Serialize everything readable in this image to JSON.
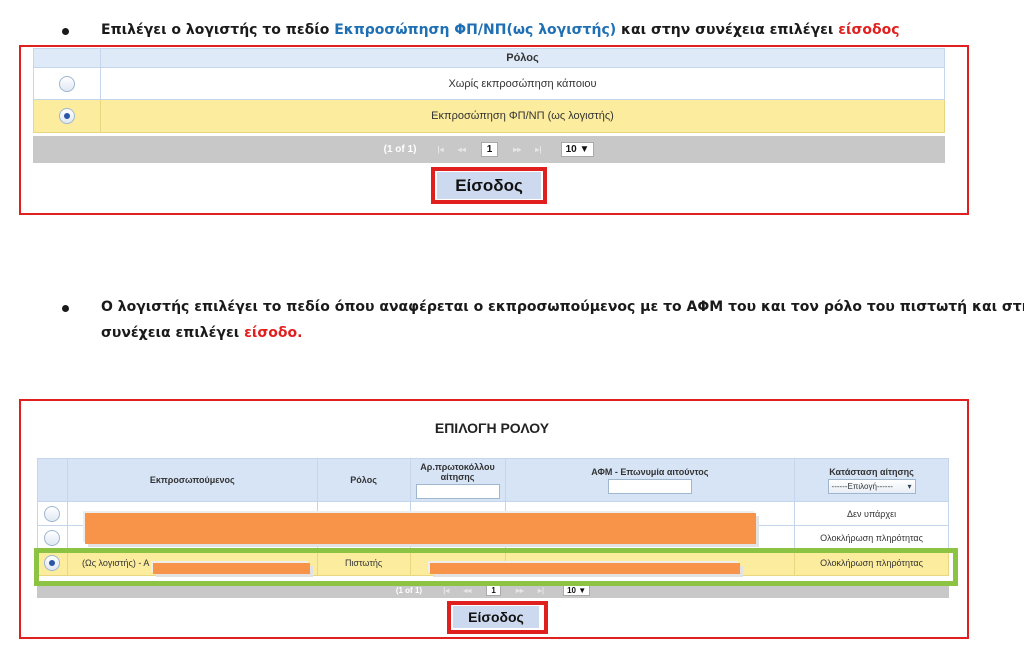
{
  "step1": {
    "text_before": "Επιλέγει ο λογιστής το πεδίο ",
    "highlight": "Εκπροσώπηση ΦΠ/ΝΠ(ως λογιστής)",
    "text_middle": " και στην συνέχεια επιλέγει ",
    "action": "είσοδος"
  },
  "panel1": {
    "column_header": "Ρόλος",
    "rows": [
      {
        "label": "Χωρίς εκπροσώπηση κάποιου",
        "selected": false
      },
      {
        "label": "Εκπροσώπηση ΦΠ/ΝΠ (ως λογιστής)",
        "selected": true
      }
    ],
    "pager": {
      "info": "(1 of 1)",
      "first": "|◂",
      "prev": "◂◂",
      "page": "1",
      "next": "▸▸",
      "last": "▸|",
      "per_page": "10 ▼"
    },
    "enter_button": "Είσοδος"
  },
  "step2": {
    "line1": "Ο λογιστής επιλέγει το πεδίο  όπου αναφέρεται ο εκπροσωπούμενος με το ΑΦΜ του και τον ρόλο του πιστωτή  και στην",
    "line2_before": "συνέχεια επιλέγει ",
    "action": "είσοδο."
  },
  "panel2": {
    "title": "ΕΠΙΛΟΓΗ ΡΟΛΟΥ",
    "headers": {
      "represented": "Εκπροσωπούμενος",
      "role": "Ρόλος",
      "protocol": "Αρ.πρωτοκόλλου αίτησης",
      "afm": "ΑΦΜ - Επωνυμία αιτούντος",
      "status": "Κατάσταση αίτησης"
    },
    "status_filter_value": "------Επιλογή------",
    "rows": [
      {
        "represented": "",
        "role": "",
        "status": "Δεν υπάρχει"
      },
      {
        "represented": "",
        "role": "",
        "status": "Ολοκλήρωση πληρότητας"
      },
      {
        "represented": "(Ως λογιστής) - Α",
        "role": "Πιστωτής",
        "status": "Ολοκλήρωση πληρότητας"
      }
    ],
    "pager": {
      "info": "(1 of 1)",
      "page": "1",
      "per_page": "10 ▼"
    },
    "enter_button": "Είσοδος"
  },
  "colors": {
    "frame_red": "#e0201e",
    "highlight_blue": "#1f6fb4",
    "selected_row": "#fbec9e",
    "redaction": "#f7944a",
    "green_frame": "#8cc342"
  }
}
